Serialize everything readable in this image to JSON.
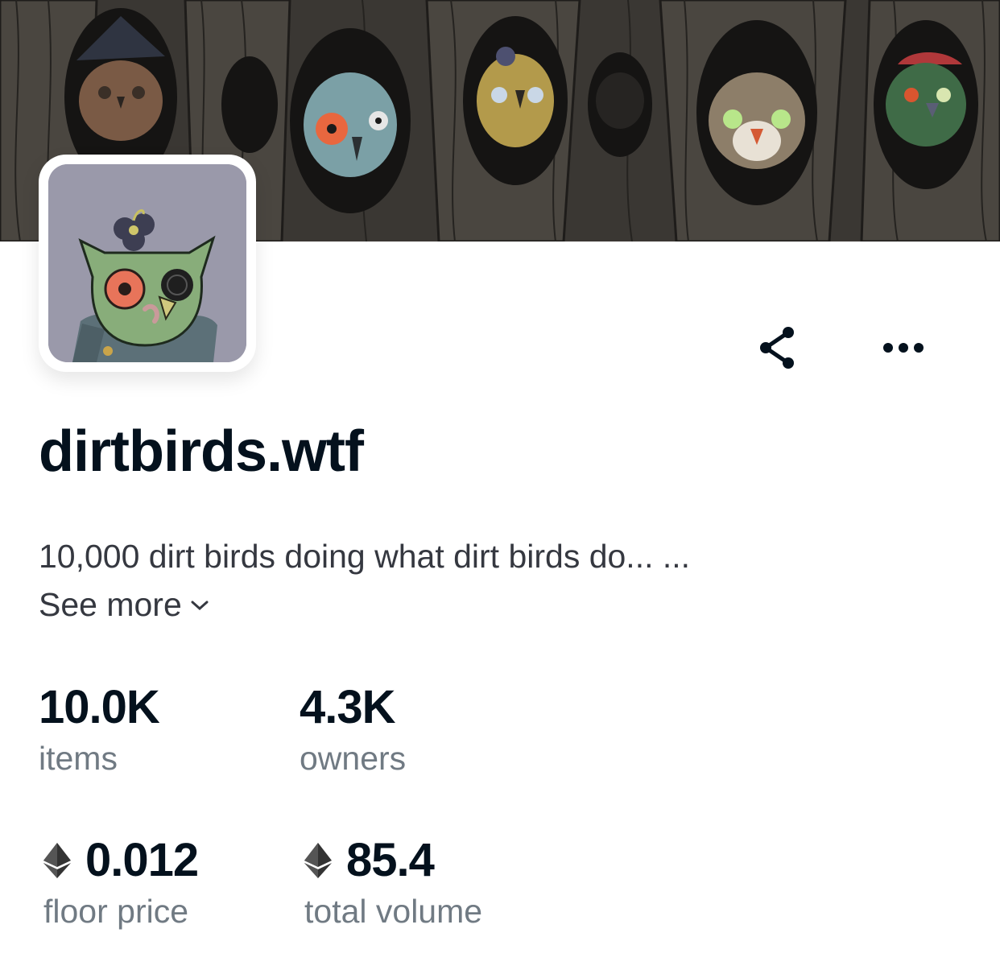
{
  "collection": {
    "name": "dirtbirds.wtf",
    "description": "10,000 dirt birds doing what dirt birds do... ...",
    "see_more_label": "See more"
  },
  "actions": {
    "share_icon": "share-icon",
    "more_icon": "more-horizontal-icon"
  },
  "stats": {
    "items": {
      "value": "10.0K",
      "label": "items"
    },
    "owners": {
      "value": "4.3K",
      "label": "owners"
    },
    "floor_price": {
      "value": "0.012",
      "label": "floor price",
      "currency_icon": "ethereum-icon"
    },
    "total_volume": {
      "value": "85.4",
      "label": "total volume",
      "currency_icon": "ethereum-icon"
    }
  },
  "colors": {
    "text_primary": "#04111d",
    "text_secondary": "#707a83",
    "banner_bg": "#3c3934",
    "avatar_bg": "#9998a8"
  }
}
